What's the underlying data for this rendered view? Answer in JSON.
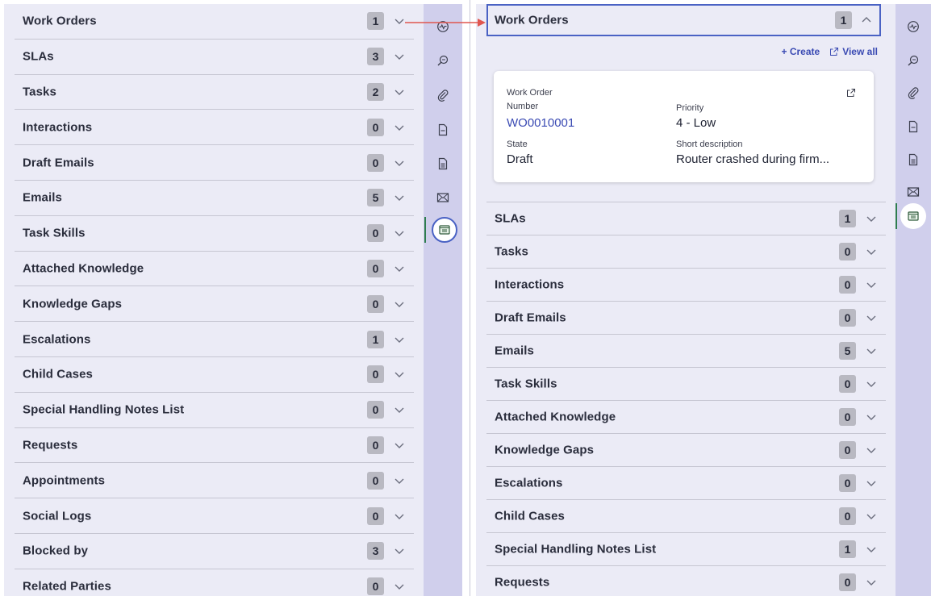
{
  "left": {
    "rows": [
      {
        "label": "Work Orders",
        "count": "1"
      },
      {
        "label": "SLAs",
        "count": "3"
      },
      {
        "label": "Tasks",
        "count": "2"
      },
      {
        "label": "Interactions",
        "count": "0"
      },
      {
        "label": "Draft Emails",
        "count": "0"
      },
      {
        "label": "Emails",
        "count": "5"
      },
      {
        "label": "Task Skills",
        "count": "0"
      },
      {
        "label": "Attached Knowledge",
        "count": "0"
      },
      {
        "label": "Knowledge Gaps",
        "count": "0"
      },
      {
        "label": "Escalations",
        "count": "1"
      },
      {
        "label": "Child Cases",
        "count": "0"
      },
      {
        "label": "Special Handling Notes List",
        "count": "0"
      },
      {
        "label": "Requests",
        "count": "0"
      },
      {
        "label": "Appointments",
        "count": "0"
      },
      {
        "label": "Social Logs",
        "count": "0"
      },
      {
        "label": "Blocked by",
        "count": "3"
      },
      {
        "label": "Related Parties",
        "count": "0"
      }
    ]
  },
  "right": {
    "header": {
      "label": "Work Orders",
      "count": "1"
    },
    "actions": {
      "create": "+ Create",
      "view_all": "View all"
    },
    "card": {
      "title": "Work Order",
      "number_label": "Number",
      "number_value": "WO0010001",
      "priority_label": "Priority",
      "priority_value": "4 - Low",
      "state_label": "State",
      "state_value": "Draft",
      "short_desc_label": "Short description",
      "short_desc_value": "Router crashed during firm..."
    },
    "rows": [
      {
        "label": "SLAs",
        "count": "1"
      },
      {
        "label": "Tasks",
        "count": "0"
      },
      {
        "label": "Interactions",
        "count": "0"
      },
      {
        "label": "Draft Emails",
        "count": "0"
      },
      {
        "label": "Emails",
        "count": "5"
      },
      {
        "label": "Task Skills",
        "count": "0"
      },
      {
        "label": "Attached Knowledge",
        "count": "0"
      },
      {
        "label": "Knowledge Gaps",
        "count": "0"
      },
      {
        "label": "Escalations",
        "count": "0"
      },
      {
        "label": "Child Cases",
        "count": "0"
      },
      {
        "label": "Special Handling Notes List",
        "count": "1"
      },
      {
        "label": "Requests",
        "count": "0"
      }
    ]
  },
  "rail_icons": [
    "activity-icon",
    "search-knowledge-icon",
    "attachment-icon",
    "document-icon",
    "document-lines-icon",
    "email-icon",
    "related-lists-icon"
  ],
  "colors": {
    "accent": "#4a62c4",
    "arrow": "#e0564f",
    "active_bar": "#2e7d4f",
    "panel_bg": "#ebebf6",
    "rail_bg": "#d0cfec"
  }
}
